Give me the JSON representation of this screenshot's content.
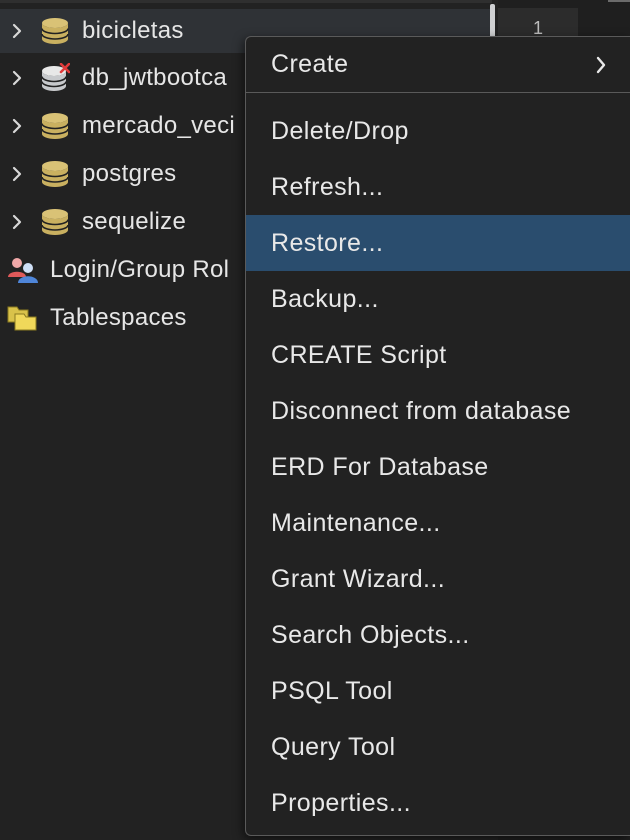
{
  "tree": {
    "items": [
      {
        "label": "bicicletas",
        "icon": "database-icon",
        "expandable": true,
        "selected": true
      },
      {
        "label": "db_jwtbootca",
        "icon": "database-disconnected-icon",
        "expandable": true,
        "selected": false
      },
      {
        "label": "mercado_veci",
        "icon": "database-icon",
        "expandable": true,
        "selected": false
      },
      {
        "label": "postgres",
        "icon": "database-icon",
        "expandable": true,
        "selected": false
      },
      {
        "label": "sequelize",
        "icon": "database-icon",
        "expandable": true,
        "selected": false
      }
    ],
    "login_group": {
      "label": "Login/Group Rol",
      "icon": "login-roles-icon"
    },
    "tablespaces": {
      "label": "Tablespaces",
      "icon": "tablespaces-folder-icon"
    }
  },
  "right_panel": {
    "tab_label": "1"
  },
  "context_menu": {
    "items": [
      {
        "label": "Create",
        "has_submenu": true,
        "active": false
      },
      {
        "label": "Delete/Drop",
        "has_submenu": false,
        "active": false
      },
      {
        "label": "Refresh...",
        "has_submenu": false,
        "active": false
      },
      {
        "label": "Restore...",
        "has_submenu": false,
        "active": true
      },
      {
        "label": "Backup...",
        "has_submenu": false,
        "active": false
      },
      {
        "label": "CREATE Script",
        "has_submenu": false,
        "active": false
      },
      {
        "label": "Disconnect from database",
        "has_submenu": false,
        "active": false
      },
      {
        "label": "ERD For Database",
        "has_submenu": false,
        "active": false
      },
      {
        "label": "Maintenance...",
        "has_submenu": false,
        "active": false
      },
      {
        "label": "Grant Wizard...",
        "has_submenu": false,
        "active": false
      },
      {
        "label": "Search Objects...",
        "has_submenu": false,
        "active": false
      },
      {
        "label": "PSQL Tool",
        "has_submenu": false,
        "active": false
      },
      {
        "label": "Query Tool",
        "has_submenu": false,
        "active": false
      },
      {
        "label": "Properties...",
        "has_submenu": false,
        "active": false
      }
    ]
  },
  "colors": {
    "background": "#222222",
    "menu_highlight": "#2a4d6e",
    "menu_border": "#5a5a5a",
    "text": "#e8e8e8",
    "database_icon": "#d9c276",
    "disconnected_mark": "#e03b3b"
  }
}
